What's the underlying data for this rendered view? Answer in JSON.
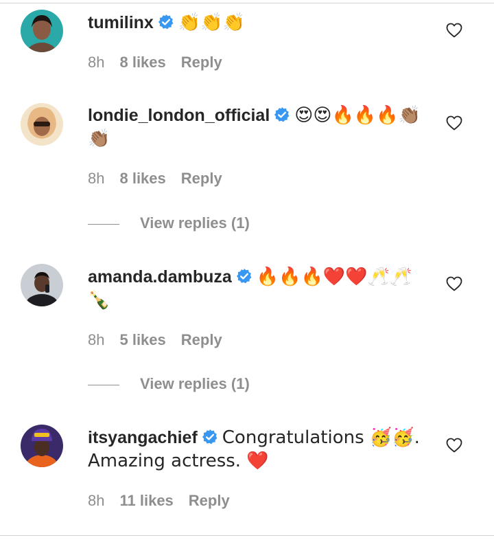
{
  "comments": [
    {
      "username": "tumilinx",
      "text": "👏👏👏",
      "time": "8h",
      "likes": "8 likes",
      "reply": "Reply"
    },
    {
      "username": "londie_london_official",
      "text": "😍😍🔥🔥🔥👏🏽👏🏽",
      "time": "8h",
      "likes": "8 likes",
      "reply": "Reply",
      "view_replies": "View replies (1)"
    },
    {
      "username": "amanda.dambuza",
      "text": "🔥🔥🔥❤️❤️🥂🥂🍾",
      "time": "8h",
      "likes": "5 likes",
      "reply": "Reply",
      "view_replies": "View replies (1)"
    },
    {
      "username": "itsyangachief",
      "text": "Congratulations 🥳🥳. Amazing actress. ❤️",
      "time": "8h",
      "likes": "11 likes",
      "reply": "Reply"
    }
  ],
  "icons": {
    "verified": "verified-badge-icon",
    "like": "heart-outline-icon"
  },
  "colors": {
    "verified_blue": "#3897f0",
    "meta_gray": "#8e8e8e",
    "text": "#262626"
  }
}
